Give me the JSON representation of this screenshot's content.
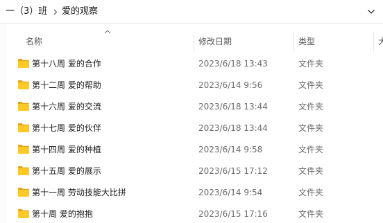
{
  "breadcrumb": {
    "items": [
      "一（3）班",
      "爱的观察"
    ]
  },
  "columns": {
    "name": "名称",
    "date": "修改日期",
    "type": "类型",
    "size": "大"
  },
  "rows": [
    {
      "name": "第十八周 爱的合作",
      "date": "2023/6/18 13:43",
      "type": "文件夹"
    },
    {
      "name": "第十二周 爱的帮助",
      "date": "2023/6/14 9:56",
      "type": "文件夹"
    },
    {
      "name": "第十六周 爱的交流",
      "date": "2023/6/18 13:44",
      "type": "文件夹"
    },
    {
      "name": "第十七周 爱的伙伴",
      "date": "2023/6/18 13:44",
      "type": "文件夹"
    },
    {
      "name": "第十四周 爱的种植",
      "date": "2023/6/14 9:58",
      "type": "文件夹"
    },
    {
      "name": "第十五周 爱的展示",
      "date": "2023/6/15 17:12",
      "type": "文件夹"
    },
    {
      "name": "第十一周 劳动技能大比拼",
      "date": "2023/6/14 9:54",
      "type": "文件夹"
    },
    {
      "name": "第十周 爱的抱抱",
      "date": "2023/6/15 17:16",
      "type": "文件夹"
    }
  ],
  "icons": {
    "folder": "folder-icon",
    "separator": "chevron-right-icon",
    "dropdown": "chevron-down-icon",
    "sort": "sort-up-icon"
  },
  "colors": {
    "folder_front": "#FFCA28",
    "folder_back": "#E8A317"
  }
}
